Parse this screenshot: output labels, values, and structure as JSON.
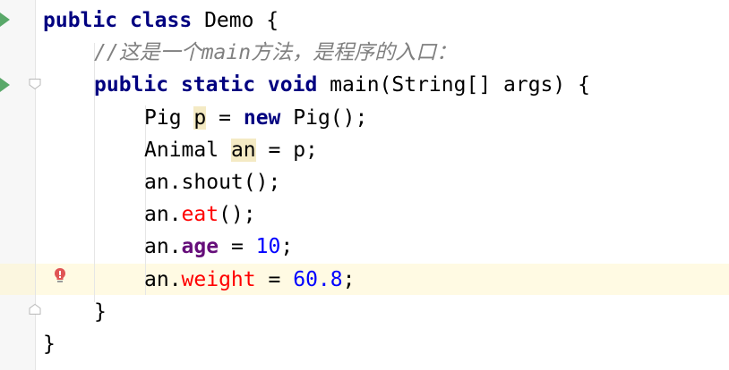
{
  "code": {
    "line1": {
      "kw1": "public",
      "kw2": "class",
      "rest": "Demo {"
    },
    "line2": {
      "comment": "//这是一个main方法，是程序的入口："
    },
    "line3": {
      "kw1": "public",
      "kw2": "static",
      "kw3": "void",
      "rest": "main(String[] args) {"
    },
    "line4": {
      "type": "Pig",
      "var": "p",
      "op": "=",
      "kw": "new",
      "rest": "Pig();"
    },
    "line5": {
      "type": "Animal",
      "var": "an",
      "rest": "= p;"
    },
    "line6": {
      "text": "an.shout();"
    },
    "line7": {
      "prefix": "an.",
      "method": "eat",
      "suffix": "();"
    },
    "line8": {
      "prefix": "an.",
      "field": "age",
      "op": "=",
      "num": "10",
      "suffix": ";"
    },
    "line9": {
      "prefix": "an.",
      "field": "weight",
      "op": "=",
      "num": "60.8",
      "suffix": ";"
    },
    "line10": {
      "text": "}"
    },
    "line11": {
      "text": "}"
    }
  },
  "colors": {
    "keyword": "#000080",
    "comment": "#808080",
    "number": "#0000ff",
    "field": "#660e7a",
    "error": "#ff0000",
    "run_icon": "#59a869",
    "caret_row": "#fffae3",
    "identifier_highlight": "#f4eac4"
  },
  "icons": {
    "run": "run-triangle-icon",
    "fold": "fold-marker-icon",
    "error_bulb": "error-bulb-icon"
  }
}
